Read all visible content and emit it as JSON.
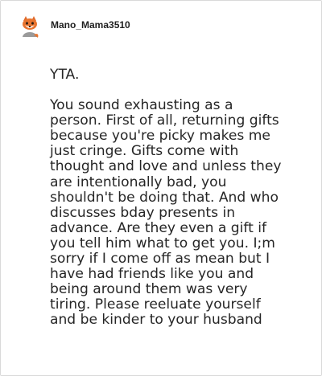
{
  "comment": {
    "username": "Mano_Mama3510",
    "avatar_icon": "fox-avatar-icon",
    "paragraphs": [
      "YTA.",
      "You sound exhausting as a\nperson. First of all, returning gifts\nbecause you're picky makes me\njust cringe. Gifts come with\nthought and love and unless they\nare intentionally bad, you\nshouldn't be doing that. And who\ndiscusses bday presents in\nadvance. Are they even a gift if\nyou tell him what to get you. I;m\nsorry if I come off as mean but I\nhave had friends like you and\nbeing around them was very\ntiring. Please reeluate yourself\nand be kinder to your husband"
    ]
  },
  "colors": {
    "text": "#262626",
    "username": "#1f1f1f",
    "border": "#d9d9d9"
  }
}
